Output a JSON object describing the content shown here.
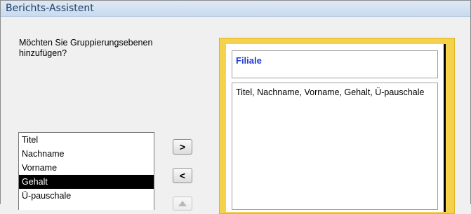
{
  "window": {
    "title": "Berichts-Assistent"
  },
  "prompt": {
    "question": "Möchten Sie Gruppierungsebenen hinzufügen?"
  },
  "fields_list": {
    "items": [
      {
        "label": "Titel",
        "selected": false
      },
      {
        "label": "Nachname",
        "selected": false
      },
      {
        "label": "Vorname",
        "selected": false
      },
      {
        "label": "Gehalt",
        "selected": true
      },
      {
        "label": "Ü-pauschale",
        "selected": false
      }
    ]
  },
  "buttons": {
    "add_label": ">",
    "remove_label": "<",
    "move_up_icon": "up-arrow-icon"
  },
  "preview": {
    "group_header": "Filiale",
    "detail_fields": "Titel, Nachname, Vorname, Gehalt, Ü-pauschale"
  },
  "colors": {
    "preview_frame": "#f5d24c",
    "group_label": "#1f3bd6",
    "selection": "#000000"
  }
}
